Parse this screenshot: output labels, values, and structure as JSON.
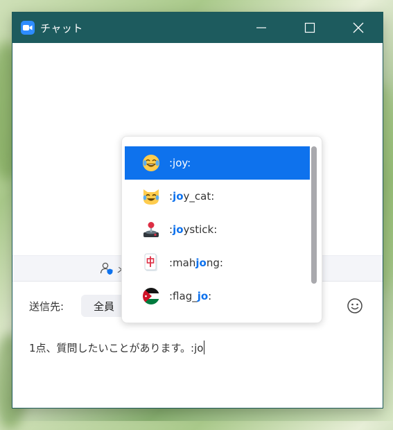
{
  "window": {
    "title": "チャット"
  },
  "privacy": {
    "text": "メ"
  },
  "compose": {
    "to_label": "送信先:",
    "recipient": "全員",
    "message": "1点、質問したいことがあります。:jo"
  },
  "autocomplete": {
    "items": [
      {
        "pre": ":joy:",
        "hl": "",
        "post": "",
        "icon": "joy-emoji",
        "selected": true
      },
      {
        "pre": ":",
        "hl": "jo",
        "post": "y_cat:",
        "icon": "joy-cat-emoji",
        "selected": false
      },
      {
        "pre": ":",
        "hl": "jo",
        "post": "ystick:",
        "icon": "joystick-emoji",
        "selected": false
      },
      {
        "pre": ":mah",
        "hl": "jo",
        "post": "ng:",
        "icon": "mahjong-emoji",
        "selected": false
      },
      {
        "pre": ":flag_",
        "hl": "jo",
        "post": ":",
        "icon": "jordan-flag-emoji",
        "selected": false
      }
    ]
  },
  "colors": {
    "titlebar": "#1d5b5e",
    "accent": "#0e72ed",
    "app_icon": "#2d8cff"
  }
}
